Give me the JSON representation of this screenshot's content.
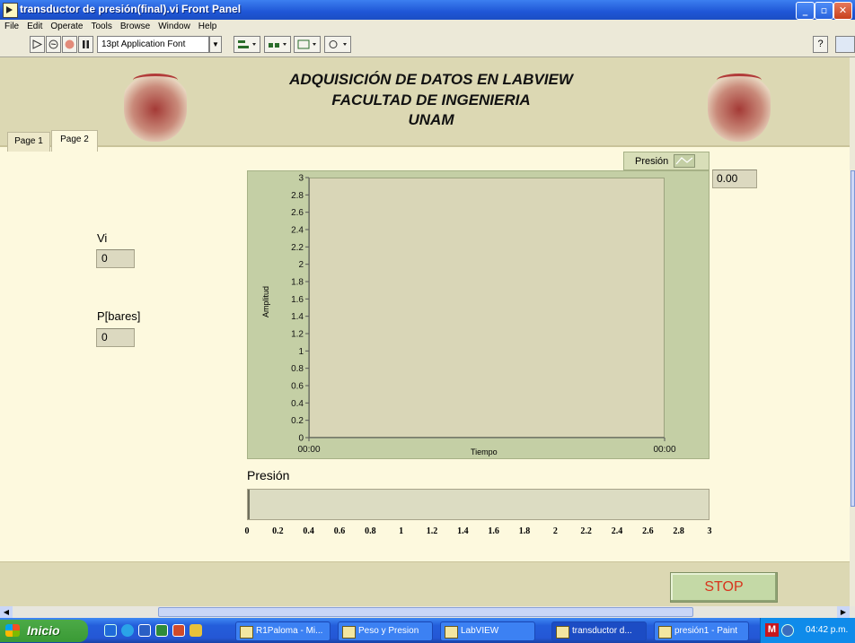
{
  "window": {
    "title": "transductor de presión(final).vi Front Panel",
    "min": "_",
    "max": "▫",
    "close": "✕"
  },
  "menu": [
    "File",
    "Edit",
    "Operate",
    "Tools",
    "Browse",
    "Window",
    "Help"
  ],
  "toolbar": {
    "font": "13pt Application Font"
  },
  "header": {
    "line1": "ADQUISICIÓN DE DATOS EN LABVIEW",
    "line2": "FACULTAD DE INGENIERIA",
    "line3": "UNAM"
  },
  "tabs": [
    "Page 1",
    "Page 2"
  ],
  "controls": {
    "vi_label": "Vi",
    "vi_value": "0",
    "p_label": "P[bares]",
    "p_value": "0",
    "digital_value": "0.00"
  },
  "chart_data": {
    "type": "line",
    "legend": "Presión",
    "xlabel": "Tiempo",
    "ylabel": "Amplitud",
    "ylim": [
      0,
      3
    ],
    "yticks": [
      "3",
      "2.8",
      "2.6",
      "2.4",
      "2.2",
      "2",
      "1.8",
      "1.6",
      "1.4",
      "1.2",
      "1",
      "0.8",
      "0.6",
      "0.4",
      "0.2",
      "0"
    ],
    "xticks": [
      "00:00",
      "00:00"
    ],
    "series": []
  },
  "slide": {
    "label": "Presión",
    "value": 0,
    "scale": [
      "0",
      "0.2",
      "0.4",
      "0.6",
      "0.8",
      "1",
      "1.2",
      "1.4",
      "1.6",
      "1.8",
      "2",
      "2.2",
      "2.4",
      "2.6",
      "2.8",
      "3"
    ]
  },
  "stop": "STOP",
  "taskbar": {
    "start": "Inicio",
    "tasks": [
      "R1Paloma - Mi...",
      "Peso y Presion",
      "LabVIEW",
      "transductor d...",
      "presión1 - Paint"
    ],
    "clock": "04:42 p.m."
  }
}
